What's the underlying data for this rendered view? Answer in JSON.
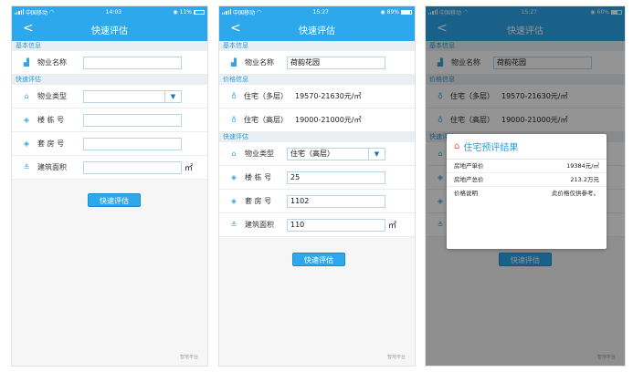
{
  "status": {
    "carrier": "中国移动",
    "screen1_time": "14:03",
    "screen1_battery": "11%",
    "screen2_time": "15:27",
    "screen2_battery": "89%",
    "screen3_time": "15:27",
    "screen3_battery": "60%"
  },
  "nav": {
    "back": "<",
    "title": "快速评估"
  },
  "sections": {
    "basic": "基本信息",
    "price": "价格信息",
    "quick": "快速评估"
  },
  "labels": {
    "property_name": "物业名称",
    "property_type": "物业类型",
    "building_no": "楼 栋 号",
    "unit_no": "套 房 号",
    "area": "建筑面积",
    "unit_sqm": "㎡"
  },
  "form": {
    "property_name": "荷韵花园",
    "property_type": "住宅（高层）",
    "building_no": "25",
    "unit_no": "1102",
    "area": "110"
  },
  "prices": [
    {
      "type": "住宅（多层）",
      "range": "19570-21630元/㎡"
    },
    {
      "type": "住宅（高层）",
      "range": "19000-21000元/㎡"
    }
  ],
  "button": {
    "label": "快速评估"
  },
  "watermark": "智地平台",
  "dialog": {
    "title": "住宅预评结果",
    "rows": [
      {
        "label": "房地产单价",
        "value": "19384元/㎡"
      },
      {
        "label": "房地产总价",
        "value": "213.2万元"
      },
      {
        "label": "价格说明",
        "value": "此价格仅供参考。"
      }
    ]
  },
  "colors": {
    "primary": "#2ea8ec",
    "section_text": "#2e9ad8"
  }
}
